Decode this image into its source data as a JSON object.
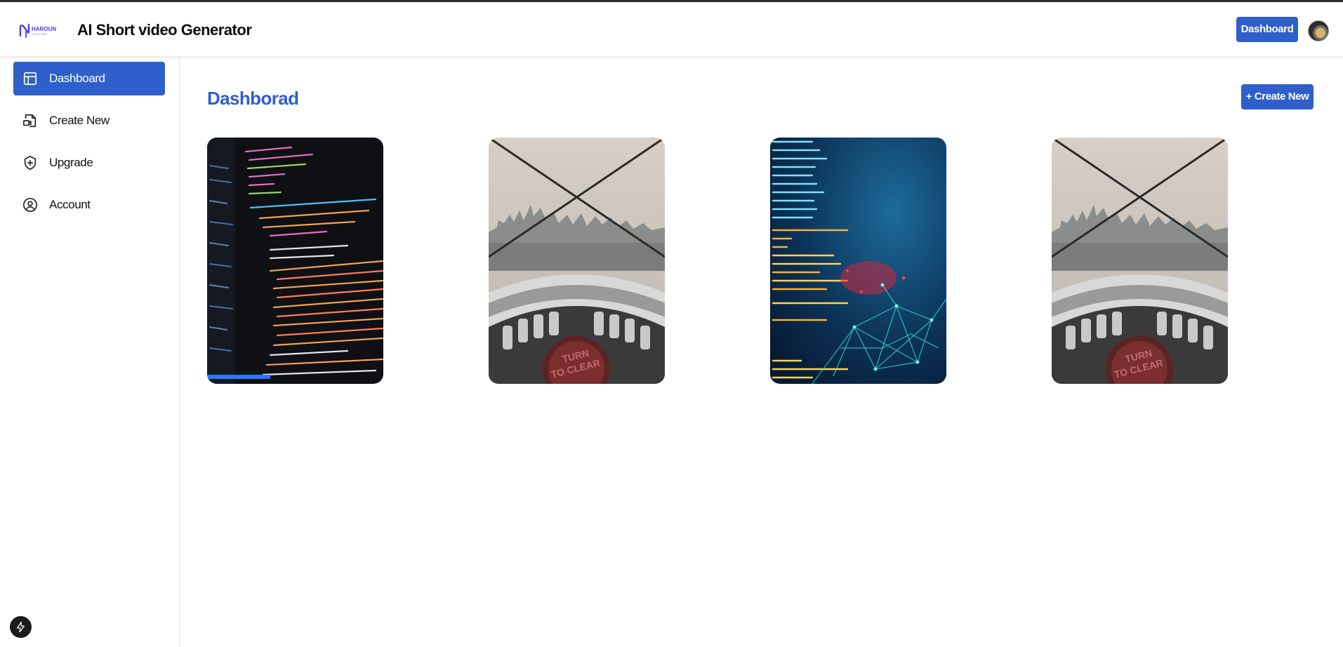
{
  "header": {
    "logo_text": "HAROUN",
    "logo_subtext": "SOLUTIONS",
    "app_title": "AI Short video Generator",
    "dashboard_button": "Dashboard"
  },
  "sidebar": {
    "items": [
      {
        "label": "Dashboard",
        "icon": "layout-icon",
        "active": true
      },
      {
        "label": "Create New",
        "icon": "file-video-icon",
        "active": false
      },
      {
        "label": "Upgrade",
        "icon": "shield-plus-icon",
        "active": false
      },
      {
        "label": "Account",
        "icon": "user-circle-icon",
        "active": false
      }
    ],
    "footer_icon": "bolt-icon"
  },
  "main": {
    "title": "Dashborad",
    "create_button": "+ Create New",
    "videos": [
      {
        "thumbnail": "code-editor-screen"
      },
      {
        "thumbnail": "city-viewer-binoculars"
      },
      {
        "thumbnail": "code-network-abstract"
      },
      {
        "thumbnail": "city-viewer-binoculars"
      }
    ]
  },
  "colors": {
    "accent": "#2f5fcb",
    "background": "#ffffff",
    "text": "#111111"
  }
}
